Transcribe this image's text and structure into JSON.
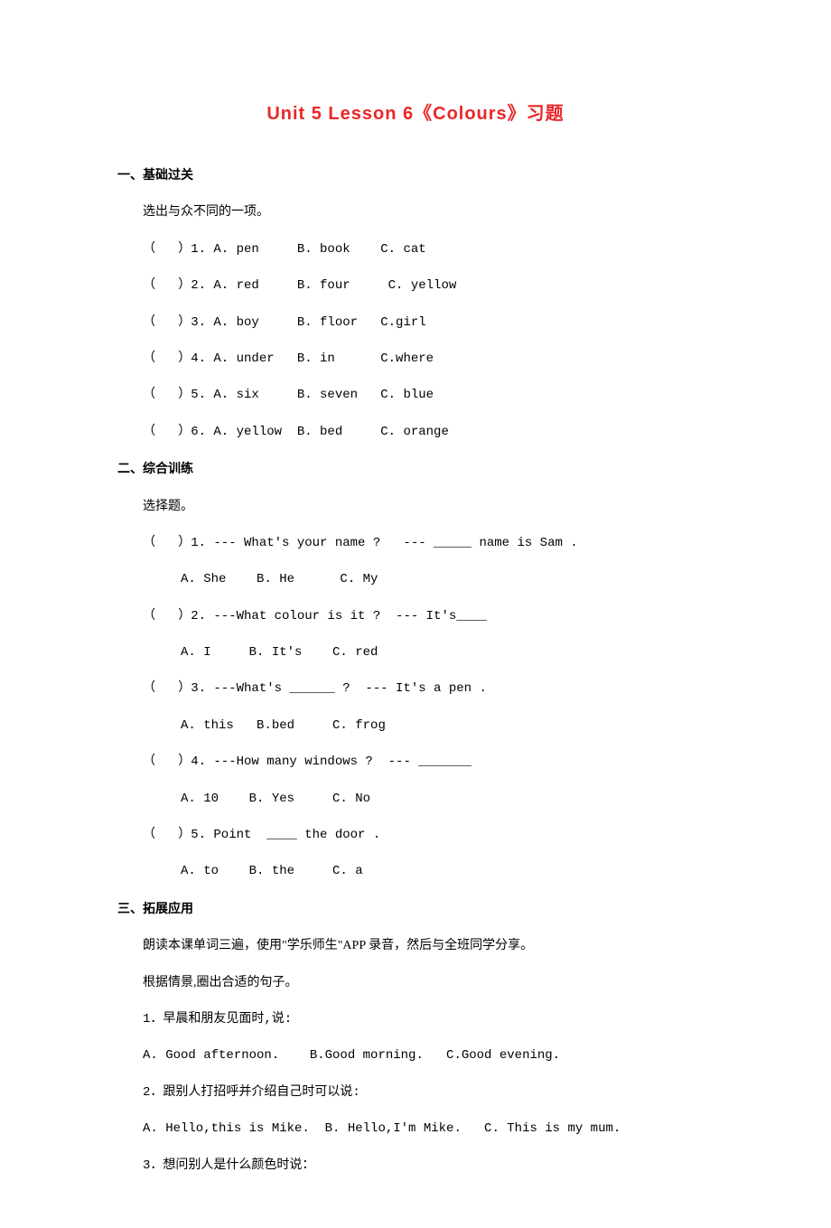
{
  "title": "Unit 5 Lesson 6《Colours》习题",
  "section1": {
    "heading": "一、基础过关",
    "instruction": "选出与众不同的一项。",
    "q1": "（   ）1. A. pen     B. book    C. cat",
    "q2": "（   ）2. A. red     B. four     C. yellow",
    "q3": "（   ）3. A. boy     B. floor   C.girl",
    "q4": "（   ）4. A. under   B. in      C.where",
    "q5": "（   ）5. A. six     B. seven   C. blue",
    "q6": "（   ）6. A. yellow  B. bed     C. orange"
  },
  "section2": {
    "heading": "二、综合训练",
    "instruction": "选择题。",
    "q1": "（   ）1. --- What's your name ?   --- _____ name is Sam .",
    "q1a": "     A. She    B. He      C. My",
    "q2": "（   ）2. ---What colour is it ?  --- It's____",
    "q2a": "     A. I     B. It's    C. red",
    "q3": "（   ）3. ---What's ______ ?  --- It's a pen .",
    "q3a": "     A. this   B.bed     C. frog",
    "q4": "（   ）4. ---How many windows ?  --- _______",
    "q4a": "     A. 10    B. Yes     C. No",
    "q5": "（   ）5. Point  ____ the door .",
    "q5a": "     A. to    B. the     C. a"
  },
  "section3": {
    "heading": "三、拓展应用",
    "instruction1": "朗读本课单词三遍，使用\"学乐师生\"APP 录音，然后与全班同学分享。",
    "instruction2": "根据情景,圈出合适的句子。",
    "q1": "1．早晨和朋友见面时,说:",
    "q1a": "A. Good afternoon.    B.Good morning.   C.Good evening.",
    "q2": "2．跟别人打招呼并介绍自己时可以说:",
    "q2a": "A. Hello,this is Mike.  B. Hello,I'm Mike.   C. This is my mum.",
    "q3": "3．想问别人是什么颜色时说："
  }
}
